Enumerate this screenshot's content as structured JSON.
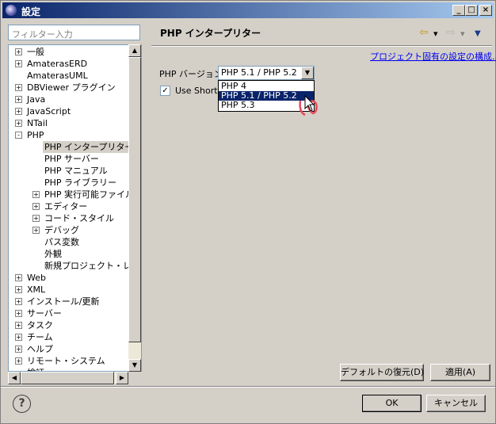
{
  "window": {
    "title": "設定"
  },
  "filter": {
    "placeholder": "フィルター入力"
  },
  "tree": {
    "items": [
      {
        "label": "一般",
        "expander": "+"
      },
      {
        "label": "AmaterasERD",
        "expander": "+"
      },
      {
        "label": "AmaterasUML",
        "expander": ""
      },
      {
        "label": "DBViewer プラグイン",
        "expander": "+"
      },
      {
        "label": "Java",
        "expander": "+"
      },
      {
        "label": "JavaScript",
        "expander": "+"
      },
      {
        "label": "NTail",
        "expander": "+"
      },
      {
        "label": "PHP",
        "expander": "-"
      },
      {
        "label": "PHP インタープリター",
        "expander": "",
        "selected": true
      },
      {
        "label": "PHP サーバー",
        "expander": ""
      },
      {
        "label": "PHP マニュアル",
        "expander": ""
      },
      {
        "label": "PHP ライブラリー",
        "expander": ""
      },
      {
        "label": "PHP 実行可能ファイル",
        "expander": "+"
      },
      {
        "label": "エディター",
        "expander": "+"
      },
      {
        "label": "コード・スタイル",
        "expander": "+"
      },
      {
        "label": "デバッグ",
        "expander": "+"
      },
      {
        "label": "パス変数",
        "expander": ""
      },
      {
        "label": "外観",
        "expander": ""
      },
      {
        "label": "新規プロジェクト・レイア",
        "expander": ""
      },
      {
        "label": "Web",
        "expander": "+"
      },
      {
        "label": "XML",
        "expander": "+"
      },
      {
        "label": "インストール/更新",
        "expander": "+"
      },
      {
        "label": "サーバー",
        "expander": "+"
      },
      {
        "label": "タスク",
        "expander": "+"
      },
      {
        "label": "チーム",
        "expander": "+"
      },
      {
        "label": "ヘルプ",
        "expander": "+"
      },
      {
        "label": "リモート・システム",
        "expander": "+"
      },
      {
        "label": "検証",
        "expander": ""
      }
    ]
  },
  "page": {
    "title": "PHP インタープリター",
    "project_link": "プロジェクト固有の設定の構成...",
    "php_version_label": "PHP バージョン:",
    "php_version_value": "PHP 5.1 / PHP 5.2",
    "dropdown_options": [
      "PHP 4",
      "PHP 5.1 / PHP 5.2",
      "PHP 5.3"
    ],
    "use_short_label": "Use Short",
    "use_short_checked": "✓"
  },
  "buttons": {
    "restore_defaults": "デフォルトの復元(D)",
    "apply": "適用(A)",
    "ok": "OK",
    "cancel": "キャンセル",
    "help": "?"
  },
  "icons": {
    "back": "⇦",
    "forward": "⇨",
    "dropdown": "▾",
    "menu": "▼"
  },
  "colors": {
    "selection": "#0a246a",
    "link": "#0000ee",
    "title_gradient_start": "#0a246a"
  }
}
